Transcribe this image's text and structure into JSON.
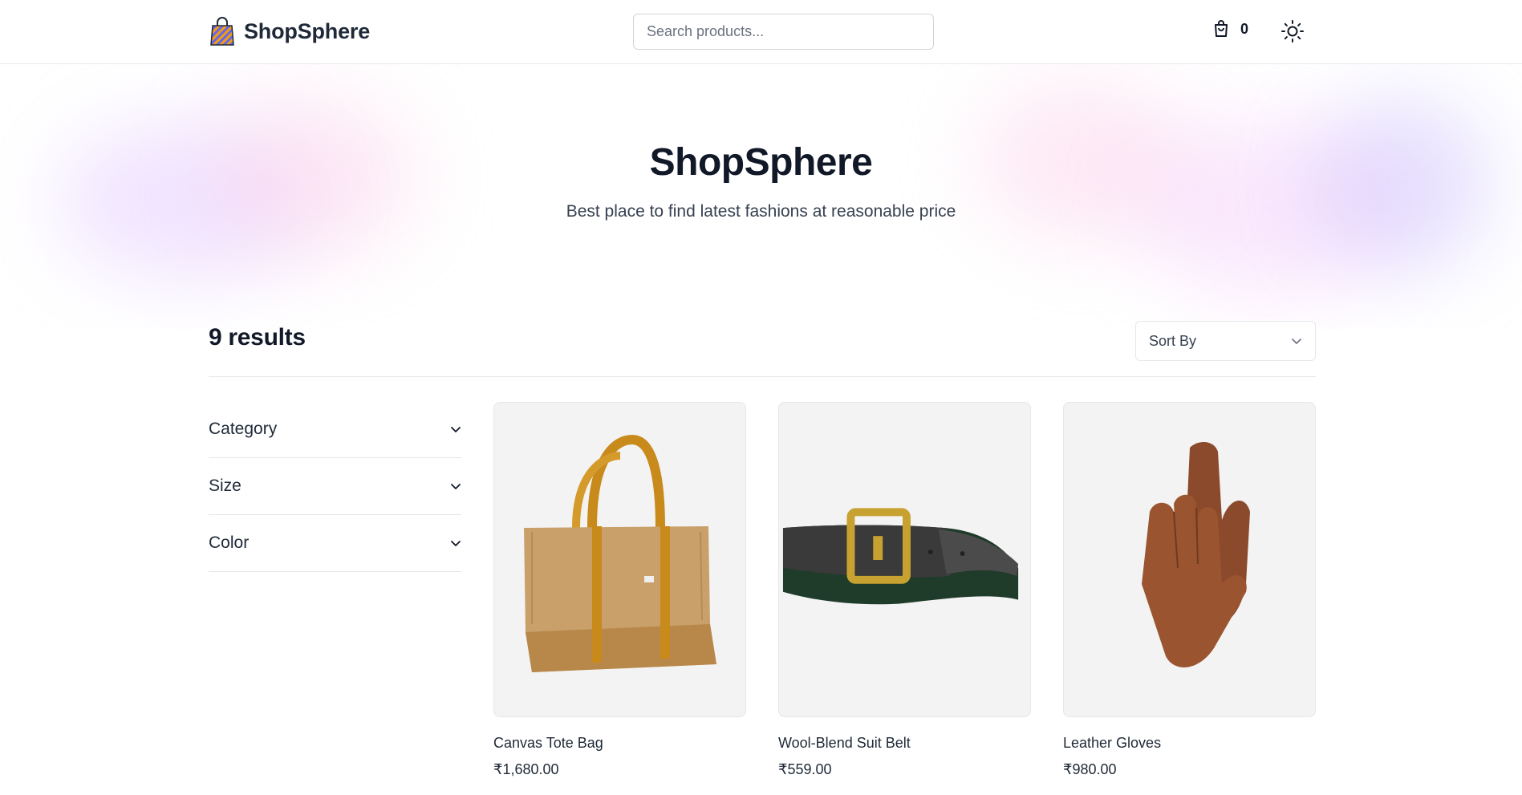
{
  "header": {
    "brand": "ShopSphere",
    "search_placeholder": "Search products...",
    "cart_count": "0",
    "icons": [
      "shopping-bag-logo-icon",
      "cart-icon",
      "sun-icon"
    ]
  },
  "hero": {
    "title": "ShopSphere",
    "subtitle": "Best place to find latest fashions at reasonable price"
  },
  "results": {
    "count_text": "9 results",
    "sort_label": "Sort By"
  },
  "filters": [
    {
      "label": "Category"
    },
    {
      "label": "Size"
    },
    {
      "label": "Color"
    }
  ],
  "products": [
    {
      "name": "Canvas Tote Bag",
      "price": "₹1,680.00",
      "image": "tote-bag-image"
    },
    {
      "name": "Wool-Blend Suit Belt",
      "price": "₹559.00",
      "image": "belt-image"
    },
    {
      "name": "Leather Gloves",
      "price": "₹980.00",
      "image": "gloves-image"
    }
  ],
  "colors": {
    "text_dark": "#111827",
    "border": "#e5e7eb",
    "card_bg": "#f3f3f3"
  }
}
